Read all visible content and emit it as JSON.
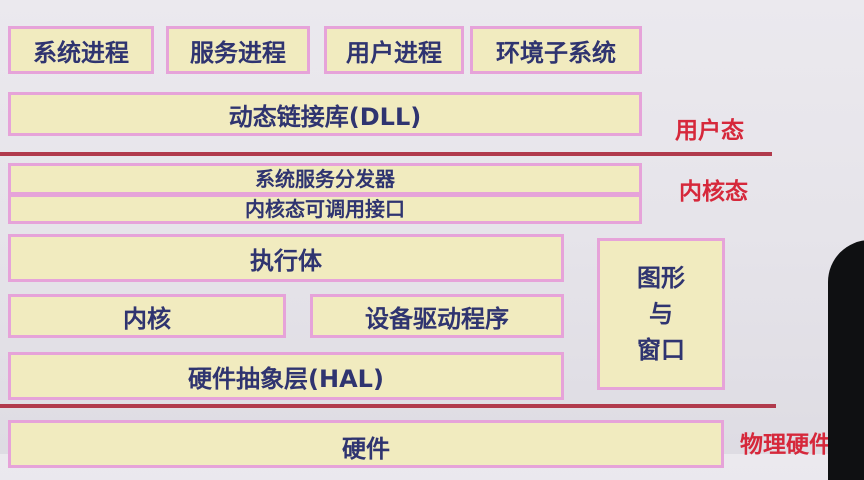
{
  "user_mode": {
    "label": "用户态",
    "processes": [
      "系统进程",
      "服务进程",
      "用户进程",
      "环境子系统"
    ],
    "dll": "动态链接库(DLL)"
  },
  "kernel_mode": {
    "label": "内核态",
    "dispatcher": "系统服务分发器",
    "interface": "内核态可调用接口",
    "executive": "执行体",
    "kernel": "内核",
    "drivers": "设备驱动程序",
    "hal": "硬件抽象层(HAL)",
    "graphics": [
      "图形",
      "与",
      "窗口"
    ]
  },
  "hardware": {
    "label": "物理硬件",
    "box": "硬件"
  },
  "colors": {
    "box_fill": "#f1ebbf",
    "box_border": "#e6a3d9",
    "box_text": "#2f3470",
    "divider": "#b13a4c",
    "mode_label": "#d6283b"
  }
}
